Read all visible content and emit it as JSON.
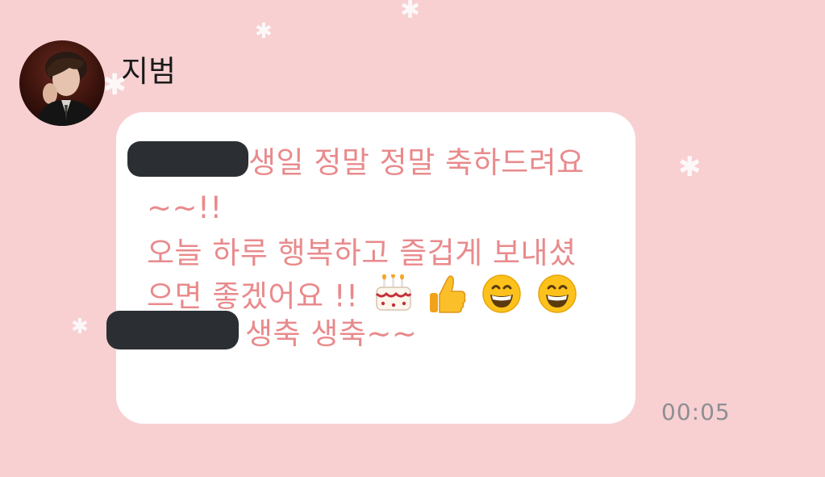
{
  "colors": {
    "background": "#f8d0d2",
    "bubble": "#ffffff",
    "message_text": "#e98a8c",
    "timestamp": "#8e8e93",
    "redaction": "#2b2f33"
  },
  "sender": {
    "name": "지범",
    "avatar": "profile-photo"
  },
  "message": {
    "line1": "생일 정말 정말 축하드려요",
    "line2": "~~!!",
    "line3": "오늘 하루 행복하고 즐겁게 보내셨",
    "line4": "으면 좋겠어요 !!",
    "line5": "생축 생축~~",
    "emojis": [
      "birthday-cake-emoji",
      "thumbs-up-emoji",
      "grinning-face-emoji",
      "grinning-face-emoji"
    ],
    "timestamp": "00:05"
  }
}
